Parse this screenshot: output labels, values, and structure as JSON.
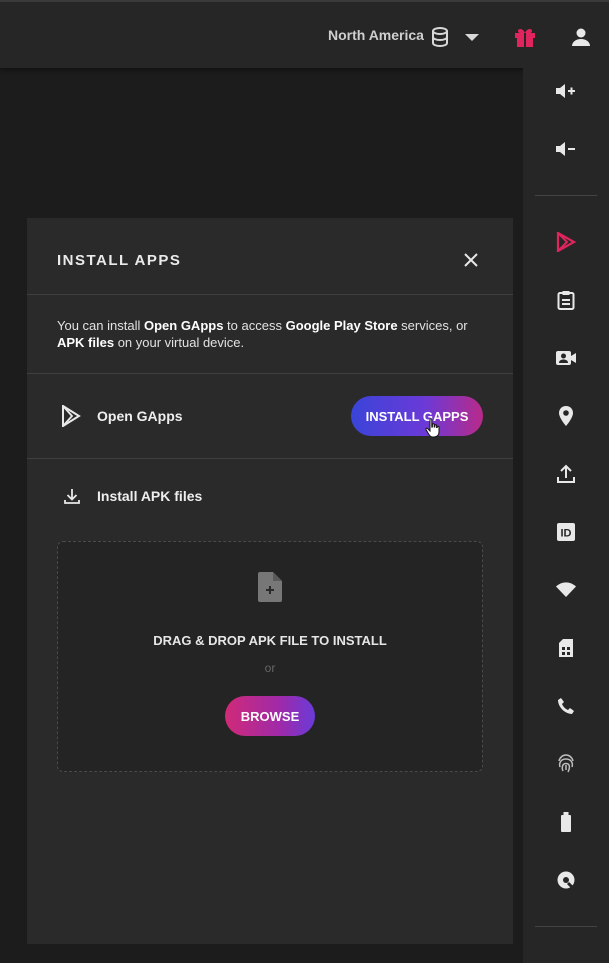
{
  "topbar": {
    "region_label": "North America",
    "icons": [
      "database-icon",
      "dropdown-caret-icon",
      "gift-icon",
      "user-icon"
    ],
    "gift_color": "#e0245e"
  },
  "sidebar": {
    "icons": [
      "volume-up-icon",
      "volume-down-icon",
      "play-store-icon",
      "clipboard-icon",
      "camera-icon",
      "location-icon",
      "upload-icon",
      "id-icon",
      "wifi-icon",
      "sim-card-icon",
      "phone-icon",
      "fingerprint-icon",
      "battery-icon",
      "disk-icon"
    ],
    "accent_color": "#e0245e"
  },
  "panel": {
    "title": "INSTALL APPS",
    "intro": {
      "p1": "You can install ",
      "b1": "Open GApps",
      "p2": " to access ",
      "b2": "Google Play Store",
      "p3": " services, or ",
      "b3": "APK files",
      "p4": " on your virtual device."
    },
    "gapps_label": "Open GApps",
    "install_gapps_button": "INSTALL GAPPS",
    "apk_label": "Install APK files",
    "dropzone": {
      "text": "DRAG & DROP APK FILE TO INSTALL",
      "or": "or",
      "browse_button": "BROWSE"
    }
  }
}
